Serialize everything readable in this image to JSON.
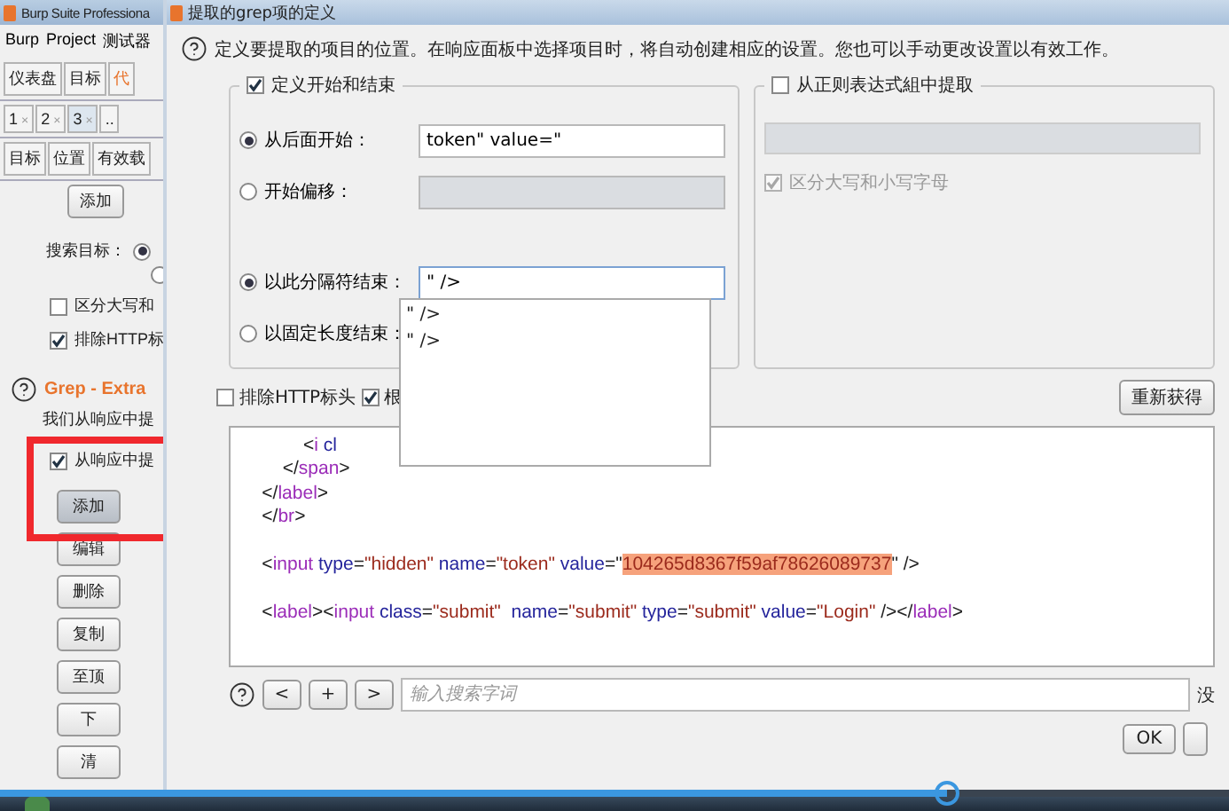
{
  "background_window": {
    "title": "Burp Suite Professiona",
    "menu": [
      "Burp",
      "Project",
      "测试器"
    ],
    "tabs": [
      {
        "label": "仪表盘",
        "highlighted": false
      },
      {
        "label": "目标",
        "highlighted": false
      },
      {
        "label": "代",
        "highlighted": true
      }
    ],
    "request_tabs": [
      {
        "label": "1",
        "close": "×",
        "selected": false
      },
      {
        "label": "2",
        "close": "×",
        "selected": false
      },
      {
        "label": "3",
        "close": "×",
        "selected": true
      },
      {
        "label": "..",
        "selected": false
      }
    ],
    "sub_tabs": [
      {
        "label": "目标"
      },
      {
        "label": "位置"
      },
      {
        "label": "有效载"
      }
    ],
    "top_button": "添加",
    "search_target": {
      "label": "搜索目标：",
      "radios": [
        {
          "selected": true
        },
        {
          "selected": false
        }
      ]
    },
    "options": [
      {
        "label": "区分大写和",
        "checked": false
      },
      {
        "label": "排除HTTP标",
        "checked": true
      }
    ],
    "section_title": "Grep - Extra",
    "section_text": "我们从响应中提",
    "extract_checkbox": {
      "label": "从响应中提",
      "checked": true
    },
    "buttons": [
      {
        "label": "添加",
        "pressed": true
      },
      {
        "label": "编辑",
        "pressed": false
      },
      {
        "label": "删除",
        "pressed": false
      },
      {
        "label": "复制",
        "pressed": false
      },
      {
        "label": "至顶",
        "pressed": false
      },
      {
        "label": "下",
        "pressed": false
      },
      {
        "label": "清",
        "pressed": false
      }
    ]
  },
  "dialog": {
    "title": "提取的grep项的定义",
    "help_text": "定义要提取的项目的位置。在响应面板中选择项目时，将自动创建相应的设置。您也可以手动更改设置以有效工作。",
    "start_end_group": {
      "label": "定义开始和结束",
      "checked": true,
      "rows": [
        {
          "label": "从后面开始：",
          "selected": true,
          "value": "token\" value=\"",
          "disabled": false,
          "focused": false
        },
        {
          "label": "开始偏移：",
          "selected": false,
          "disabled": true,
          "focused": false
        },
        {
          "label": "以此分隔符结束：",
          "selected": true,
          "value": "\" />",
          "disabled": false,
          "focused": true
        },
        {
          "label": "以固定长度结束：",
          "selected": false
        }
      ]
    },
    "dropdown_items": [
      "\" />",
      "\" />"
    ],
    "regex_group": {
      "label": "从正则表达式組中提取",
      "checked": false,
      "case_option": {
        "label": "区分大写和小写字母",
        "checked": true
      }
    },
    "exclude_headers": {
      "label": "排除HTTP标头",
      "checked": false
    },
    "second_option": {
      "label": "根",
      "checked": true
    },
    "refetch_button": "重新获得",
    "code_lines": [
      {
        "kind": "code",
        "tokens": [
          {
            "kind": "punct",
            "text": "            <"
          },
          {
            "kind": "tag",
            "text": "i"
          },
          {
            "kind": "attr",
            "text": " cl"
          }
        ]
      },
      {
        "kind": "code",
        "tokens": [
          {
            "kind": "punct",
            "text": "        </"
          },
          {
            "kind": "tag",
            "text": "span"
          },
          {
            "kind": "punct",
            "text": ">"
          }
        ]
      },
      {
        "kind": "code",
        "tokens": [
          {
            "kind": "punct",
            "text": "    </"
          },
          {
            "kind": "tag",
            "text": "label"
          },
          {
            "kind": "punct",
            "text": ">"
          }
        ]
      },
      {
        "kind": "code",
        "tokens": [
          {
            "kind": "punct",
            "text": "    </"
          },
          {
            "kind": "tag",
            "text": "br"
          },
          {
            "kind": "punct",
            "text": ">"
          }
        ]
      },
      {
        "kind": "blank"
      },
      {
        "kind": "code",
        "tokens": [
          {
            "kind": "punct",
            "text": "    <"
          },
          {
            "kind": "tag",
            "text": "input"
          },
          {
            "kind": "attr",
            "text": " type"
          },
          {
            "kind": "punct",
            "text": "="
          },
          {
            "kind": "value",
            "text": "\"hidden\""
          },
          {
            "kind": "attr",
            "text": " name"
          },
          {
            "kind": "punct",
            "text": "="
          },
          {
            "kind": "value",
            "text": "\"token\""
          },
          {
            "kind": "attr",
            "text": " value"
          },
          {
            "kind": "punct",
            "text": "=\""
          },
          {
            "kind": "highlight",
            "text": "104265d8367f59af78626089737"
          },
          {
            "kind": "punct",
            "text": "\" />"
          }
        ]
      },
      {
        "kind": "blank"
      },
      {
        "kind": "code",
        "tokens": [
          {
            "kind": "punct",
            "text": "    <"
          },
          {
            "kind": "tag",
            "text": "label"
          },
          {
            "kind": "punct",
            "text": "><"
          },
          {
            "kind": "tag",
            "text": "input"
          },
          {
            "kind": "attr",
            "text": " class"
          },
          {
            "kind": "punct",
            "text": "="
          },
          {
            "kind": "value",
            "text": "\"submit\""
          },
          {
            "kind": "attr",
            "text": "  name"
          },
          {
            "kind": "punct",
            "text": "="
          },
          {
            "kind": "value",
            "text": "\"submit\""
          },
          {
            "kind": "attr",
            "text": " type"
          },
          {
            "kind": "punct",
            "text": "="
          },
          {
            "kind": "value",
            "text": "\"submit\""
          },
          {
            "kind": "attr",
            "text": " value"
          },
          {
            "kind": "punct",
            "text": "="
          },
          {
            "kind": "value",
            "text": "\"Login\""
          },
          {
            "kind": "punct",
            "text": " /></"
          },
          {
            "kind": "tag",
            "text": "label"
          },
          {
            "kind": "punct",
            "text": ">"
          }
        ]
      }
    ],
    "search_buttons": [
      "<",
      "+",
      ">"
    ],
    "search_placeholder": "输入搜索字词",
    "match_text": "没",
    "ok_button": "OK"
  },
  "video_progress": {
    "level": 0.77
  }
}
